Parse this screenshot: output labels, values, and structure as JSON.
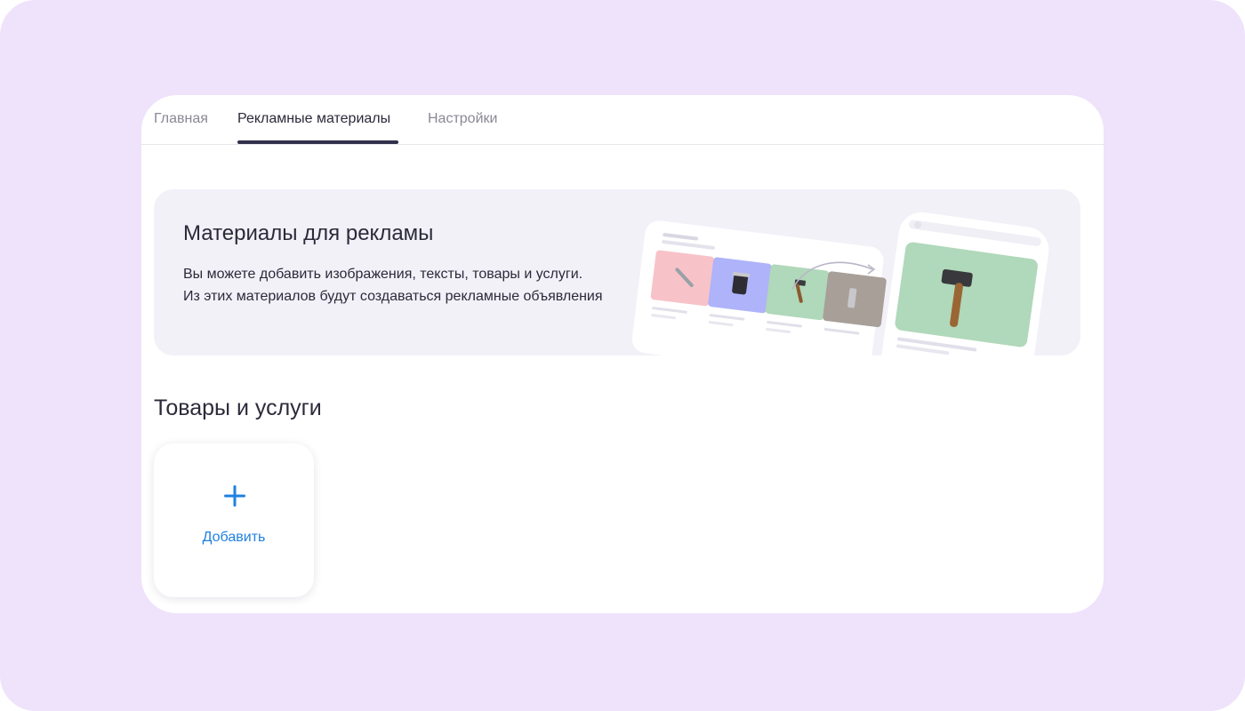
{
  "tabs": [
    {
      "label": "Главная",
      "active": false
    },
    {
      "label": "Рекламные материалы",
      "active": true
    },
    {
      "label": "Настройки",
      "active": false
    }
  ],
  "banner": {
    "title": "Материалы для рекламы",
    "line1": "Вы можете добавить изображения, тексты, товары и услуги.",
    "line2": "Из этих материалов будут создаваться рекламные объявления"
  },
  "products": {
    "title": "Товары и услуги",
    "add_label": "Добавить"
  },
  "colors": {
    "background": "#efe2fb",
    "accent": "#1f80e0",
    "tab_underline": "#312f4a",
    "banner_bg": "#f2f1f8"
  },
  "icons": {
    "add": "plus-icon"
  }
}
